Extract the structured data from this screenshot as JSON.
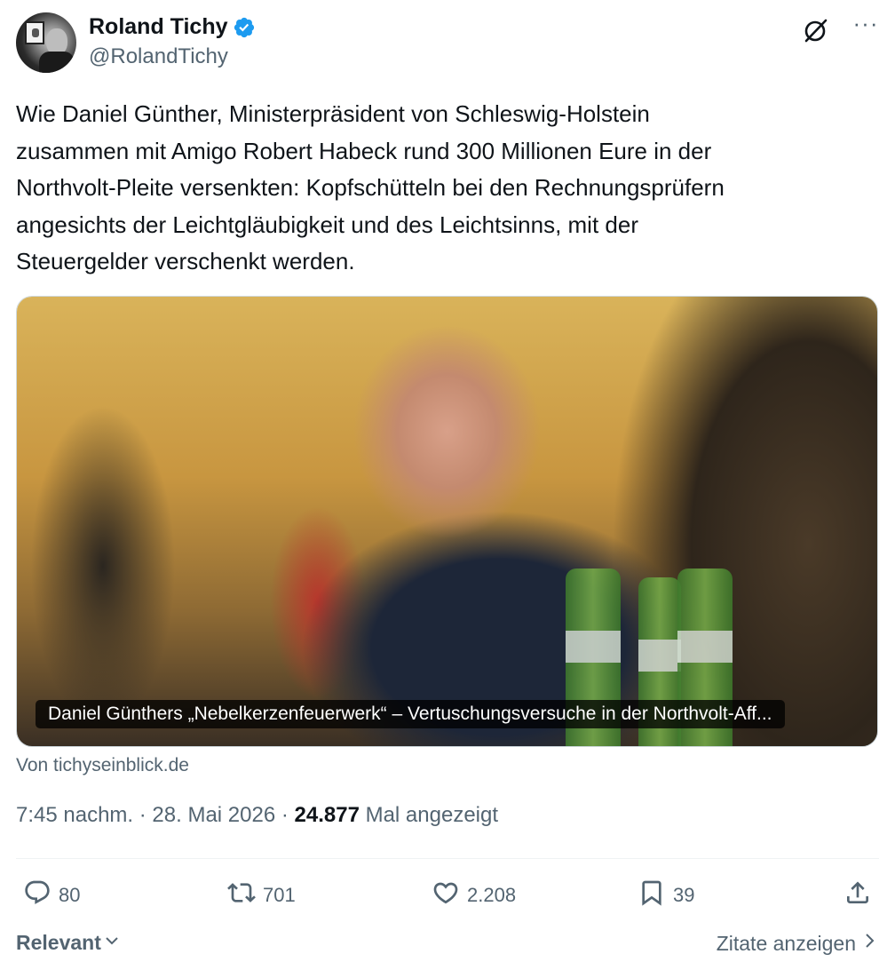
{
  "author": {
    "name": "Roland Tichy",
    "handle": "@RolandTichy",
    "verified": true
  },
  "header": {
    "grok_icon": "grok-icon",
    "more_icon": "more-options-icon",
    "more_label": "···"
  },
  "tweet": {
    "text": "Wie Daniel Günther, Ministerpräsident von Schleswig-Holstein\nzusammen mit Amigo Robert Habeck rund 300 Millionen Eure in der\nNorthvolt-Pleite versenkten: Kopfschütteln bei den Rechnungsprüfern\nangesichts  der Leichtgläubigkeit und des Leichtsinns, mit der\nSteuergelder verschenkt werden."
  },
  "card": {
    "caption": "Daniel Günthers „Nebelkerzenfeuerwerk“ – Vertuschungsversuche in der Northvolt-Aff...",
    "source": "Von tichyseinblick.de"
  },
  "meta": {
    "time": "7:45 nachm.",
    "separator": " · ",
    "date": "28. Mai 2026",
    "views_count": "24.877",
    "views_label": " Mal angezeigt"
  },
  "actions": {
    "replies": "80",
    "reposts": "701",
    "likes": "2.208",
    "bookmarks": "39"
  },
  "footer": {
    "sort_label": "Relevant",
    "quotes_label": "Zitate anzeigen"
  },
  "colors": {
    "text_primary": "#0f1419",
    "text_secondary": "#536471",
    "verified_blue": "#1d9bf0",
    "border": "#cfd9de"
  }
}
